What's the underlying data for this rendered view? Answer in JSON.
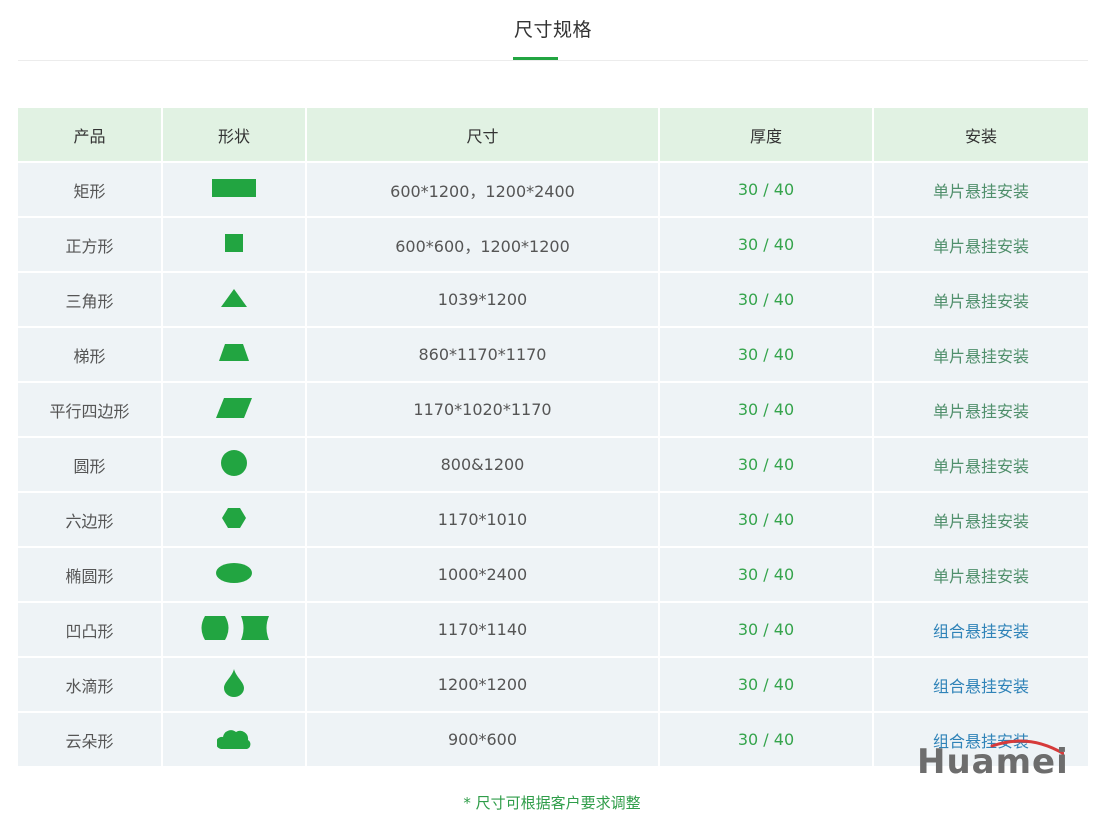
{
  "page": {
    "title": "尺寸规格",
    "footnote": "* 尺寸可根据客户要求调整"
  },
  "colors": {
    "accent_green": "#22a541",
    "header_bg": "#e1f2e3",
    "row_bg": "#eef3f6",
    "thickness_text": "#35a44c",
    "single_install_text": "#4f8f6b",
    "combo_install_text": "#2f83b8"
  },
  "table": {
    "headers": [
      "产品",
      "形状",
      "尺寸",
      "厚度",
      "安装"
    ],
    "rows": [
      {
        "product": "矩形",
        "shape_icons": [
          "rectangle-icon"
        ],
        "size": "600*1200，1200*2400",
        "thickness": "30 / 40",
        "install": "单片悬挂安装",
        "install_type": "single"
      },
      {
        "product": "正方形",
        "shape_icons": [
          "square-icon"
        ],
        "size": "600*600，1200*1200",
        "thickness": "30 / 40",
        "install": "单片悬挂安装",
        "install_type": "single"
      },
      {
        "product": "三角形",
        "shape_icons": [
          "triangle-icon"
        ],
        "size": "1039*1200",
        "thickness": "30 / 40",
        "install": "单片悬挂安装",
        "install_type": "single"
      },
      {
        "product": "梯形",
        "shape_icons": [
          "trapezoid-icon"
        ],
        "size": "860*1170*1170",
        "thickness": "30 / 40",
        "install": "单片悬挂安装",
        "install_type": "single"
      },
      {
        "product": "平行四边形",
        "shape_icons": [
          "parallelogram-icon"
        ],
        "size": "1170*1020*1170",
        "thickness": "30 / 40",
        "install": "单片悬挂安装",
        "install_type": "single"
      },
      {
        "product": "圆形",
        "shape_icons": [
          "circle-icon"
        ],
        "size": "800&1200",
        "thickness": "30 / 40",
        "install": "单片悬挂安装",
        "install_type": "single"
      },
      {
        "product": "六边形",
        "shape_icons": [
          "hexagon-icon"
        ],
        "size": "1170*1010",
        "thickness": "30 / 40",
        "install": "单片悬挂安装",
        "install_type": "single"
      },
      {
        "product": "椭圆形",
        "shape_icons": [
          "ellipse-icon"
        ],
        "size": "1000*2400",
        "thickness": "30 / 40",
        "install": "单片悬挂安装",
        "install_type": "single"
      },
      {
        "product": "凹凸形",
        "shape_icons": [
          "convex-icon",
          "concave-icon"
        ],
        "size": "1170*1140",
        "thickness": "30 / 40",
        "install": "组合悬挂安装",
        "install_type": "combo"
      },
      {
        "product": "水滴形",
        "shape_icons": [
          "water-drop-icon"
        ],
        "size": "1200*1200",
        "thickness": "30 / 40",
        "install": "组合悬挂安装",
        "install_type": "combo"
      },
      {
        "product": "云朵形",
        "shape_icons": [
          "cloud-icon"
        ],
        "size": "900*600",
        "thickness": "30 / 40",
        "install": "组合悬挂安装",
        "install_type": "combo"
      }
    ]
  },
  "watermark": {
    "brand_text": "Huamei"
  }
}
